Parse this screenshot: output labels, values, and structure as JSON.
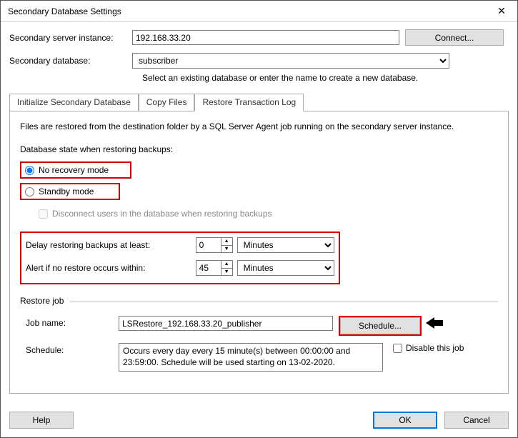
{
  "window": {
    "title": "Secondary Database Settings"
  },
  "form": {
    "server_label": "Secondary server instance:",
    "server_value": "192.168.33.20",
    "connect_label": "Connect...",
    "db_label": "Secondary database:",
    "db_value": "subscriber",
    "db_helper": "Select an existing database or enter the name to create a new database."
  },
  "tabs": {
    "init": "Initialize Secondary Database",
    "copy": "Copy Files",
    "restore": "Restore Transaction Log"
  },
  "restore": {
    "intro": "Files are restored from the destination folder by a SQL Server Agent job running on the secondary server instance.",
    "state_label": "Database state when restoring backups:",
    "no_recovery": "No recovery mode",
    "standby": "Standby mode",
    "disconnect": "Disconnect users in the database when restoring backups",
    "delay_label": "Delay restoring backups at least:",
    "delay_value": "0",
    "delay_unit": "Minutes",
    "alert_label": "Alert if no restore occurs within:",
    "alert_value": "45",
    "alert_unit": "Minutes",
    "fieldset": "Restore job",
    "jobname_label": "Job name:",
    "jobname_value": "LSRestore_192.168.33.20_publisher",
    "schedule_btn": "Schedule...",
    "schedule_label": "Schedule:",
    "schedule_text": "Occurs every day every 15 minute(s) between 00:00:00 and 23:59:00. Schedule will be used starting on 13-02-2020.",
    "disable_label": "Disable this job"
  },
  "footer": {
    "help": "Help",
    "ok": "OK",
    "cancel": "Cancel"
  }
}
